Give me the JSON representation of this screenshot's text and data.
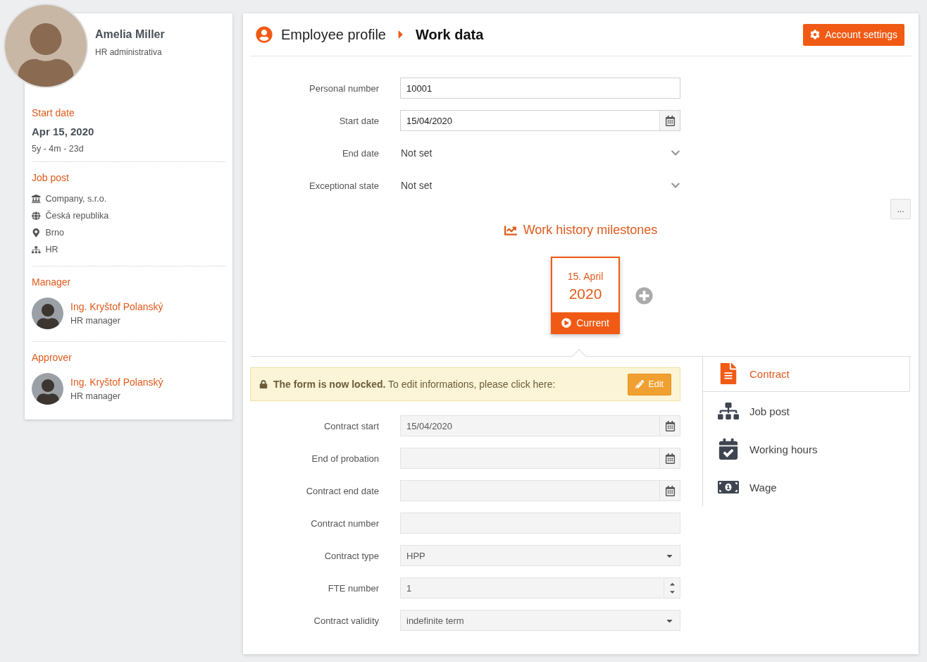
{
  "profile": {
    "name": "Amelia Miller",
    "role": "HR administrativa"
  },
  "start": {
    "heading": "Start date",
    "date": "Apr 15, 2020",
    "duration": "5y - 4m - 23d"
  },
  "job_post": {
    "heading": "Job post",
    "items": [
      {
        "kind": "building",
        "text": "Company, s.r.o."
      },
      {
        "kind": "globe",
        "text": "Česká republika"
      },
      {
        "kind": "pin",
        "text": "Brno"
      },
      {
        "kind": "org",
        "text": "HR"
      }
    ]
  },
  "people": [
    {
      "heading": "Manager",
      "name": "Ing. Kryštof Polanský",
      "role": "HR manager"
    },
    {
      "heading": "Approver",
      "name": "Ing. Kryštof Polanský",
      "role": "HR manager"
    }
  ],
  "breadcrumb": {
    "parent": "Employee profile",
    "current": "Work data"
  },
  "account_button": "Account settings",
  "work_fields": [
    {
      "kind": "text",
      "label": "Personal number",
      "value": "10001",
      "disabled": false
    },
    {
      "kind": "date",
      "label": "Start date",
      "value": "15/04/2020",
      "disabled": false
    },
    {
      "kind": "plain_select",
      "label": "End date",
      "value": "Not set",
      "disabled": false
    },
    {
      "kind": "plain_select",
      "label": "Exceptional state",
      "value": "Not set",
      "disabled": false
    }
  ],
  "more_button": "...",
  "milestones": {
    "title": "Work history milestones",
    "items": [
      {
        "day": "15. April",
        "year": "2020",
        "status": "Current",
        "selected": true
      }
    ]
  },
  "lock_notice": {
    "text": "**The form is now locked.** To edit informations, please click here:",
    "button": "Edit"
  },
  "contract_fields": [
    {
      "kind": "date",
      "label": "Contract start",
      "value": "15/04/2020",
      "disabled": true
    },
    {
      "kind": "date",
      "label": "End of probation",
      "disabled": true
    },
    {
      "kind": "date",
      "label": "Contract end date",
      "disabled": true
    },
    {
      "kind": "text",
      "label": "Contract number",
      "disabled": true
    },
    {
      "kind": "select",
      "label": "Contract type",
      "value": "HPP",
      "disabled": true
    },
    {
      "kind": "number",
      "label": "FTE number",
      "value": "1",
      "disabled": true
    },
    {
      "kind": "select",
      "label": "Contract validity",
      "value": "indefinite term",
      "disabled": true
    }
  ],
  "sections": [
    {
      "kind": "file",
      "label": "Contract",
      "selected": true
    },
    {
      "kind": "org",
      "label": "Job post",
      "selected": false
    },
    {
      "kind": "calendar",
      "label": "Working hours",
      "selected": false
    },
    {
      "kind": "money",
      "label": "Wage",
      "selected": false
    }
  ]
}
